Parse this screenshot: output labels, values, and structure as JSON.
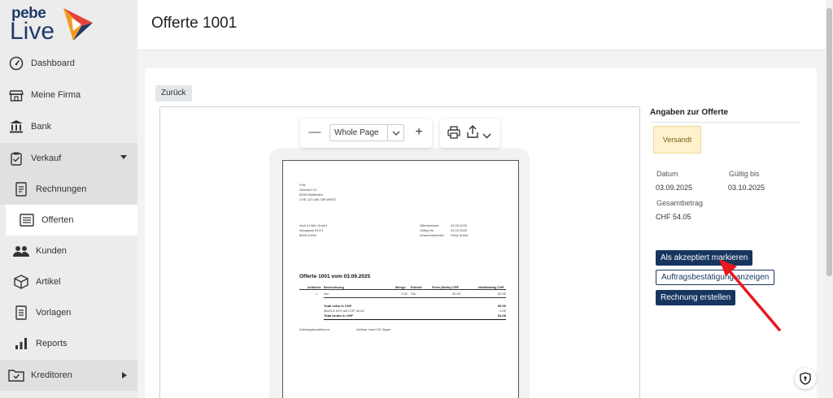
{
  "brand": {
    "top": "pebe",
    "bottom": "Live",
    "colors": {
      "navy": "#1f3a6b",
      "red": "#e8423a",
      "orange": "#f39a1e"
    }
  },
  "sidebar": {
    "items": [
      {
        "label": "Dashboard",
        "icon": "dashboard-gauge-icon"
      },
      {
        "label": "Meine Firma",
        "icon": "shop-icon"
      },
      {
        "label": "Bank",
        "icon": "bank-icon"
      },
      {
        "label": "Verkauf",
        "icon": "clipboard-check-icon"
      },
      {
        "label": "Rechnungen",
        "icon": "document-icon"
      },
      {
        "label": "Offerten",
        "icon": "quote-list-icon"
      },
      {
        "label": "Kunden",
        "icon": "users-icon"
      },
      {
        "label": "Artikel",
        "icon": "box-icon"
      },
      {
        "label": "Vorlagen",
        "icon": "template-icon"
      },
      {
        "label": "Reports",
        "icon": "bar-chart-icon"
      },
      {
        "label": "Kreditoren",
        "icon": "folder-check-icon"
      }
    ]
  },
  "header": {
    "title": "Offerte 1001"
  },
  "main": {
    "back_label": "Zurück",
    "viewer": {
      "zoom_value": "Whole Page",
      "zoom_minus": "—",
      "zoom_plus": "+",
      "doc": {
        "sender": [
          "Fritz",
          "Oberdorf 12",
          "8008 Wallisellen",
          "CHE-123.456.789 MWST"
        ],
        "recipient": [
          "AAA 4 KMU GmbH",
          "Neugasse 81/13",
          "8005 Zürich"
        ],
        "meta_labels": [
          "Offertedatum:",
          "Gültig bis:",
          "Ansprechpartner:"
        ],
        "meta_values": [
          "03.09.2025",
          "03.10.2025",
          "Rudy Nüssli"
        ],
        "title": "Offerte 1001 vom 03.09.2025",
        "columns": [
          "Artikelnr.",
          "Bezeichnung",
          "Menge",
          "Einheit",
          "Preis (Netto) CHF",
          "Nettobetrag CHF"
        ],
        "row": [
          "1",
          "Am",
          "1.00",
          "Stk",
          "50.00",
          "50.00"
        ],
        "totals_labels": [
          "Total netto in CHF",
          "MwSt 8.10% auf CHF 50.00",
          "Total brutto in CHF"
        ],
        "totals_values": [
          "50.00",
          "4.05",
          "54.05"
        ],
        "terms_label": "Zahlungskonditionen",
        "terms_value": "Zahlbar innert 30 Tagen"
      }
    }
  },
  "panel": {
    "title": "Angaben zur Offerte",
    "status": "Versandt",
    "date_label": "Datum",
    "date_value": "03.09.2025",
    "valid_label": "Gültig bis",
    "valid_value": "03.10.2025",
    "total_label": "Gesamtbetrag",
    "total_value": "CHF 54.05",
    "btn_accept": "Als akzeptiert markieren",
    "btn_order": "Auftragsbestätigung anzeigen",
    "btn_invoice": "Rechnung erstellen"
  }
}
